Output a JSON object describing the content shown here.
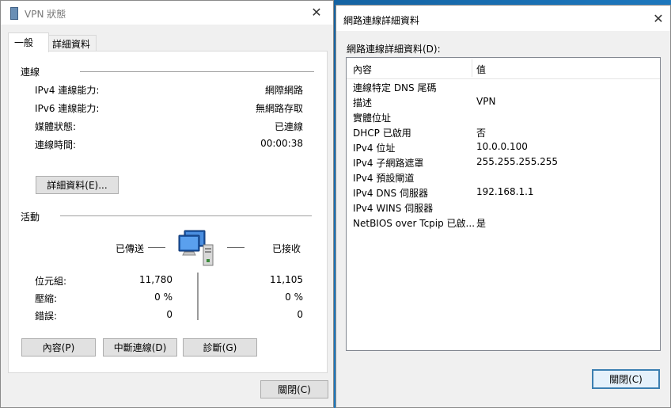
{
  "left": {
    "title": "VPN 狀態",
    "tabs": [
      "一般",
      "詳細資料"
    ],
    "connection": {
      "header": "連線",
      "rows": [
        {
          "label": "IPv4 連線能力:",
          "value": "網際網路"
        },
        {
          "label": "IPv6 連線能力:",
          "value": "無網路存取"
        },
        {
          "label": "媒體狀態:",
          "value": "已連線"
        },
        {
          "label": "連線時間:",
          "value": "00:00:38"
        }
      ],
      "details_button": "詳細資料(E)..."
    },
    "activity": {
      "header": "活動",
      "sent_label": "已傳送",
      "received_label": "已接收",
      "rows": [
        {
          "label": "位元組:",
          "sent": "11,780",
          "received": "11,105"
        },
        {
          "label": "壓縮:",
          "sent": "0 %",
          "received": "0 %"
        },
        {
          "label": "錯誤:",
          "sent": "0",
          "received": "0"
        }
      ]
    },
    "buttons": {
      "properties": "內容(P)",
      "disconnect": "中斷連線(D)",
      "diagnose": "診斷(G)"
    },
    "close_button": "關閉(C)"
  },
  "right": {
    "title": "網路連線詳細資料",
    "list_label": "網路連線詳細資料(D):",
    "columns": [
      "內容",
      "值"
    ],
    "rows": [
      {
        "property": "連線特定 DNS 尾碼",
        "value": ""
      },
      {
        "property": "描述",
        "value": "VPN"
      },
      {
        "property": "實體位址",
        "value": ""
      },
      {
        "property": "DHCP 已啟用",
        "value": "否"
      },
      {
        "property": "IPv4 位址",
        "value": "10.0.0.100"
      },
      {
        "property": "IPv4 子網路遮罩",
        "value": "255.255.255.255"
      },
      {
        "property": "IPv4 預設閘道",
        "value": ""
      },
      {
        "property": "IPv4 DNS 伺服器",
        "value": "192.168.1.1"
      },
      {
        "property": "IPv4 WINS 伺服器",
        "value": ""
      },
      {
        "property": "NetBIOS over Tcpip 已啟...",
        "value": "是"
      }
    ],
    "close_button": "關閉(C)"
  },
  "icons": {
    "vpn": "vpn-network-icon",
    "computers": "network-computers-icon",
    "close": "close-icon"
  }
}
